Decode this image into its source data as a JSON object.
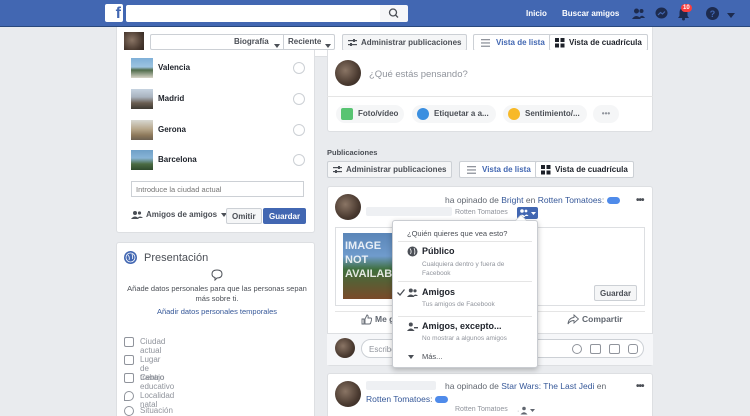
{
  "topbar": {
    "search": {
      "placeholder": "",
      "value": ""
    },
    "nav": {
      "home": "Inicio",
      "find_friends": "Buscar amigos"
    },
    "notifications_count": "10"
  },
  "cover": {
    "biografia": "Biografía",
    "reciente": "Reciente",
    "manage_posts": "Administrar publicaciones",
    "list_view": "Vista de lista",
    "grid_view": "Vista de cuadrícula"
  },
  "cities": {
    "items": [
      {
        "name": "Valencia"
      },
      {
        "name": "Madrid"
      },
      {
        "name": "Gerona"
      },
      {
        "name": "Barcelona"
      }
    ],
    "input_placeholder": "Introduce la ciudad actual",
    "audience": "Amigos de amigos",
    "skip": "Omitir",
    "save": "Guardar"
  },
  "presentation": {
    "title": "Presentación",
    "description": "Añade datos personales para que las personas sepan más sobre ti.",
    "add_link": "Añadir datos personales temporales",
    "items": [
      {
        "label": "Ciudad actual"
      },
      {
        "label": "Lugar de trabajo"
      },
      {
        "label": "Centro educativo"
      },
      {
        "label": "Localidad natal"
      },
      {
        "label": "Situación sentimental"
      }
    ]
  },
  "composer": {
    "placeholder": "¿Qué estás pensando?",
    "photo": "Foto/vídeo",
    "tag": "Etiquetar a a...",
    "feeling": "Sentimiento/...",
    "more": "•••"
  },
  "posts_section": {
    "heading": "Publicaciones",
    "manage_posts": "Administrar publicaciones",
    "list_view": "Vista de lista",
    "grid_view": "Vista de cuadrícula"
  },
  "post1": {
    "action": "ha opinado de",
    "subject": "Bright",
    "in": "en",
    "site": "Rotten Tomatoes",
    "colon": ":",
    "source": "Rotten Tomatoes",
    "image_text": "IMAGE NOT AVAILABLE",
    "save": "Guardar",
    "like": "Me gusta",
    "share": "Compartir",
    "comment_placeholder": "Escribe un comentario..."
  },
  "privacy_menu": {
    "header": "¿Quién quieres que vea esto?",
    "options": [
      {
        "title": "Público",
        "desc": "Cualquiera dentro y fuera de Facebook"
      },
      {
        "title": "Amigos",
        "desc": "Tus amigos de Facebook"
      },
      {
        "title": "Amigos, excepto...",
        "desc": "No mostrar a algunos amigos"
      }
    ],
    "more": "Más..."
  },
  "post2": {
    "action": "ha opinado de",
    "subject": "Star Wars: The Last Jedi",
    "in": "en",
    "site": "Rotten Tomatoes",
    "colon": ":",
    "source": "Rotten Tomatoes"
  },
  "colors": {
    "brand": "#4267b2",
    "link": "#365899",
    "badge": "#fa3e3e"
  }
}
